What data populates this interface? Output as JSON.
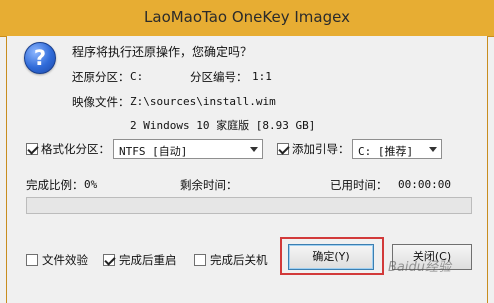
{
  "window": {
    "title": "LaoMaoTao OneKey Imagex"
  },
  "prompt": {
    "question": "程序将执行还原操作，您确定吗？"
  },
  "info": {
    "restore_partition_label": "还原分区：",
    "restore_partition_value": "C:",
    "partition_number_label": "分区编号：",
    "partition_number_value": "1:1",
    "image_file_label": "映像文件：",
    "image_file_value": "Z:\\sources\\install.wim",
    "image_index_line": "2 Windows 10 家庭版 [8.93 GB]"
  },
  "options": {
    "format_checkbox_label": "格式化分区：",
    "format_checked": true,
    "format_combo_value": "NTFS [自动]",
    "bootloader_checkbox_label": "添加引导：",
    "bootloader_checked": true,
    "bootloader_combo_value": "C: [推荐]"
  },
  "status": {
    "complete_ratio_label": "完成比例：",
    "complete_ratio_value": "0%",
    "remaining_time_label": "剩余时间：",
    "elapsed_time_label": "已用时间：",
    "elapsed_time_value": "00:00:00",
    "progress_percent": 0
  },
  "footer": {
    "verify_label": "文件效验",
    "verify_checked": false,
    "reboot_label": "完成后重启",
    "reboot_checked": true,
    "shutdown_label": "完成后关机",
    "shutdown_checked": false,
    "ok_button": "确定(Y)",
    "cancel_button": "关闭(C)"
  },
  "overlay": {
    "watermark": "Baidu经验"
  },
  "colors": {
    "titlebar": "#e7ad33",
    "highlight": "#d23a3a",
    "question_icon": "#2f6ad8"
  }
}
